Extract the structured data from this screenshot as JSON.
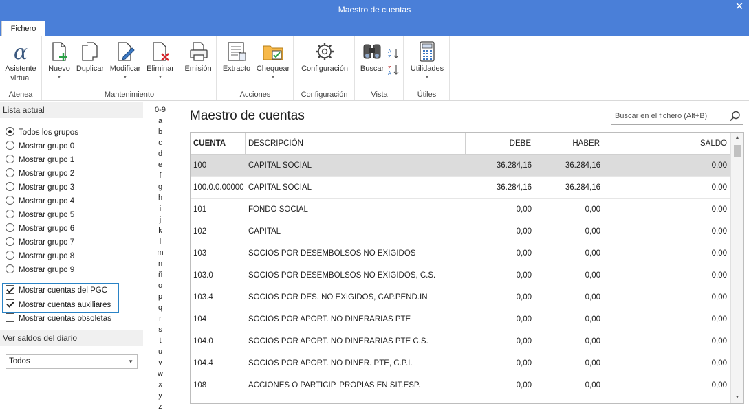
{
  "window": {
    "title": "Maestro de cuentas",
    "close_glyph": "✕"
  },
  "tabs": [
    {
      "label": "Fichero"
    }
  ],
  "ribbon": {
    "groups": [
      {
        "title": "Atenea",
        "buttons": [
          {
            "label": "Asistente virtual",
            "icon": "alpha-assistant-icon"
          }
        ]
      },
      {
        "title": "Mantenimiento",
        "buttons": [
          {
            "label": "Nuevo",
            "icon": "new-document-icon",
            "dropdown": true
          },
          {
            "label": "Duplicar",
            "icon": "duplicate-icon"
          },
          {
            "label": "Modificar",
            "icon": "edit-document-icon",
            "dropdown": true
          },
          {
            "label": "Eliminar",
            "icon": "delete-document-icon",
            "dropdown": true
          },
          {
            "label": "Emisión",
            "icon": "print-icon"
          }
        ]
      },
      {
        "title": "Acciones",
        "buttons": [
          {
            "label": "Extracto",
            "icon": "extract-icon"
          },
          {
            "label": "Chequear",
            "icon": "check-folder-icon",
            "dropdown": true
          }
        ]
      },
      {
        "title": "Configuración",
        "buttons": [
          {
            "label": "Configuración",
            "icon": "gear-icon"
          }
        ]
      },
      {
        "title": "Vista",
        "buttons": [
          {
            "label": "Buscar",
            "icon": "binoculars-icon"
          },
          {
            "label": "",
            "icon": "sort-az-icon"
          },
          {
            "label": "",
            "icon": "sort-za-icon"
          }
        ]
      },
      {
        "title": "Útiles",
        "buttons": [
          {
            "label": "Utilidades",
            "icon": "calculator-icon",
            "dropdown": true
          }
        ]
      }
    ]
  },
  "left_panel": {
    "list_header": "Lista actual",
    "radios": [
      {
        "label": "Todos los grupos",
        "selected": true
      },
      {
        "label": "Mostrar grupo 0",
        "selected": false
      },
      {
        "label": "Mostrar grupo 1",
        "selected": false
      },
      {
        "label": "Mostrar grupo 2",
        "selected": false
      },
      {
        "label": "Mostrar grupo 3",
        "selected": false
      },
      {
        "label": "Mostrar grupo 4",
        "selected": false
      },
      {
        "label": "Mostrar grupo 5",
        "selected": false
      },
      {
        "label": "Mostrar grupo 6",
        "selected": false
      },
      {
        "label": "Mostrar grupo 7",
        "selected": false
      },
      {
        "label": "Mostrar grupo 8",
        "selected": false
      },
      {
        "label": "Mostrar grupo 9",
        "selected": false
      }
    ],
    "checks": [
      {
        "label": "Mostrar cuentas del PGC",
        "checked": true
      },
      {
        "label": "Mostrar cuentas auxiliares",
        "checked": true
      },
      {
        "label": "Mostrar cuentas obsoletas",
        "checked": false
      }
    ],
    "saldos_header": "Ver saldos del diario",
    "saldos_select": {
      "value": "Todos"
    }
  },
  "alphabet": [
    "0-9",
    "a",
    "b",
    "c",
    "d",
    "e",
    "f",
    "g",
    "h",
    "i",
    "j",
    "k",
    "l",
    "m",
    "n",
    "ñ",
    "o",
    "p",
    "q",
    "r",
    "s",
    "t",
    "u",
    "v",
    "w",
    "x",
    "y",
    "z"
  ],
  "main": {
    "title": "Maestro de cuentas",
    "search_placeholder": "Buscar en el fichero (Alt+B)",
    "columns": [
      "CUENTA",
      "DESCRIPCIÓN",
      "DEBE",
      "HABER",
      "SALDO"
    ],
    "rows": [
      {
        "cuenta": "100",
        "descripcion": "CAPITAL SOCIAL",
        "debe": "36.284,16",
        "haber": "36.284,16",
        "saldo": "0,00"
      },
      {
        "cuenta": "100.0.0.00000",
        "descripcion": "CAPITAL SOCIAL",
        "debe": "36.284,16",
        "haber": "36.284,16",
        "saldo": "0,00"
      },
      {
        "cuenta": "101",
        "descripcion": "FONDO SOCIAL",
        "debe": "0,00",
        "haber": "0,00",
        "saldo": "0,00"
      },
      {
        "cuenta": "102",
        "descripcion": "CAPITAL",
        "debe": "0,00",
        "haber": "0,00",
        "saldo": "0,00"
      },
      {
        "cuenta": "103",
        "descripcion": "SOCIOS POR DESEMBOLSOS NO EXIGIDOS",
        "debe": "0,00",
        "haber": "0,00",
        "saldo": "0,00"
      },
      {
        "cuenta": "103.0",
        "descripcion": "SOCIOS POR DESEMBOLSOS NO EXIGIDOS, C.S.",
        "debe": "0,00",
        "haber": "0,00",
        "saldo": "0,00"
      },
      {
        "cuenta": "103.4",
        "descripcion": "SOCIOS POR DES. NO EXIGIDOS, CAP.PEND.IN",
        "debe": "0,00",
        "haber": "0,00",
        "saldo": "0,00"
      },
      {
        "cuenta": "104",
        "descripcion": "SOCIOS POR APORT. NO DINERARIAS PTE",
        "debe": "0,00",
        "haber": "0,00",
        "saldo": "0,00"
      },
      {
        "cuenta": "104.0",
        "descripcion": "SOCIOS POR APORT. NO DINERARIAS PTE C.S.",
        "debe": "0,00",
        "haber": "0,00",
        "saldo": "0,00"
      },
      {
        "cuenta": "104.4",
        "descripcion": "SOCIOS POR APORT. NO DINER. PTE, C.P.I.",
        "debe": "0,00",
        "haber": "0,00",
        "saldo": "0,00"
      },
      {
        "cuenta": "108",
        "descripcion": "ACCIONES O PARTICIP. PROPIAS EN SIT.ESP.",
        "debe": "0,00",
        "haber": "0,00",
        "saldo": "0,00"
      }
    ],
    "selected_row": 0
  }
}
